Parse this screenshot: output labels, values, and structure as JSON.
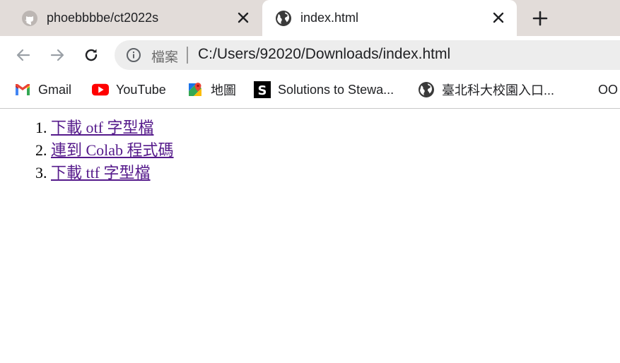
{
  "tabs": [
    {
      "title": "phoebbbbe/ct2022s",
      "favicon": "github-icon",
      "active": false
    },
    {
      "title": "index.html",
      "favicon": "globe-icon",
      "active": true
    }
  ],
  "toolbar": {
    "security_chip": "檔案",
    "url": "C:/Users/92020/Downloads/index.html"
  },
  "bookmarks": [
    {
      "label": "Gmail",
      "icon": "gmail-icon"
    },
    {
      "label": "YouTube",
      "icon": "youtube-icon"
    },
    {
      "label": "地圖",
      "icon": "maps-icon"
    },
    {
      "label": "Solutions to Stewa...",
      "icon": "slader-icon"
    },
    {
      "label": "臺北科大校園入口...",
      "icon": "globe-icon"
    },
    {
      "label": "OO",
      "icon": ""
    }
  ],
  "page": {
    "links": [
      {
        "number": "1.",
        "text": "下載 otf 字型檔"
      },
      {
        "number": "2.",
        "text": "連到 Colab 程式碼"
      },
      {
        "number": "3.",
        "text": "下載 ttf 字型檔"
      }
    ]
  },
  "colors": {
    "tabstrip": "#e2dcd9",
    "omnibox": "#ededed",
    "visited_link": "#551a8b"
  }
}
